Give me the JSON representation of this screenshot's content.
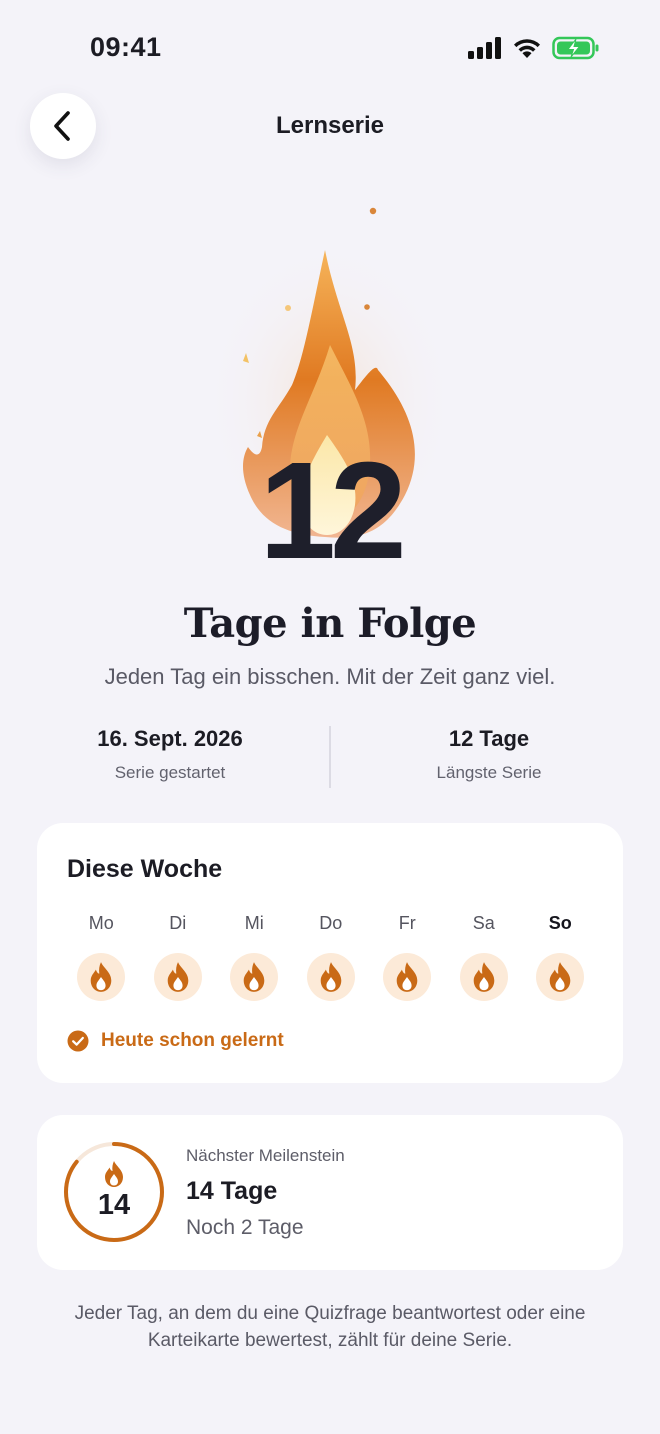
{
  "status_bar": {
    "time": "09:41",
    "icons": [
      "signal-icon",
      "wifi-icon",
      "battery-charging-icon"
    ]
  },
  "nav": {
    "title": "Lernserie",
    "back_icon": "chevron-left-icon"
  },
  "hero": {
    "streak_count": "12",
    "headline": "Tage in Folge",
    "subline": "Jeden Tag ein bisschen. Mit der Zeit ganz viel."
  },
  "stats": {
    "started": {
      "value": "16. Sept. 2026",
      "label": "Serie gestartet"
    },
    "longest": {
      "value": "12 Tage",
      "label": "Längste Serie"
    }
  },
  "week": {
    "title": "Diese Woche",
    "days": [
      {
        "label": "Mo",
        "completed": true,
        "today": false
      },
      {
        "label": "Di",
        "completed": true,
        "today": false
      },
      {
        "label": "Mi",
        "completed": true,
        "today": false
      },
      {
        "label": "Do",
        "completed": true,
        "today": false
      },
      {
        "label": "Fr",
        "completed": true,
        "today": false
      },
      {
        "label": "Sa",
        "completed": true,
        "today": false
      },
      {
        "label": "So",
        "completed": true,
        "today": true
      }
    ],
    "status_text": "Heute schon gelernt"
  },
  "milestone": {
    "label": "Nächster Meilenstein",
    "target": "14",
    "value": "14 Tage",
    "remaining": "Noch 2 Tage",
    "progress": 0.857
  },
  "footnote": "Jeder Tag, an dem du eine Quizfrage beantwortest oder eine Karteikarte bewertest, zählt für deine Serie.",
  "colors": {
    "accent": "#C96A16",
    "flame_bg": "#FCEAD8",
    "background": "#F4F3F9",
    "card": "#FFFFFF",
    "battery": "#34C759"
  }
}
